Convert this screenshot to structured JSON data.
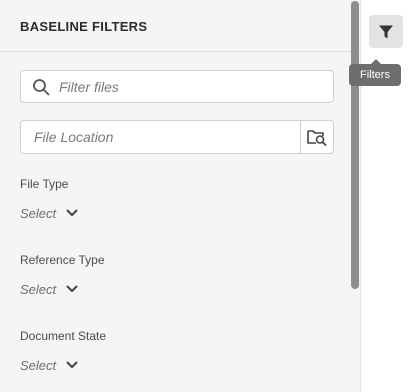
{
  "panel": {
    "title": "BASELINE FILTERS",
    "search": {
      "placeholder": "Filter files",
      "value": ""
    },
    "location": {
      "placeholder": "File Location",
      "value": ""
    },
    "filters": [
      {
        "label": "File Type",
        "value": "Select"
      },
      {
        "label": "Reference Type",
        "value": "Select"
      },
      {
        "label": "Document State",
        "value": "Select"
      }
    ]
  },
  "toolbar": {
    "filter_tooltip": "Filters"
  },
  "icons": {
    "search": "search-icon",
    "browse": "folder-search-icon",
    "chevron": "chevron-down-icon",
    "filter": "filter-icon"
  },
  "colors": {
    "panel_bg": "#f5f5f5",
    "tooltip_bg": "#6e6e6e",
    "scroll_thumb": "#8e8e8e"
  }
}
